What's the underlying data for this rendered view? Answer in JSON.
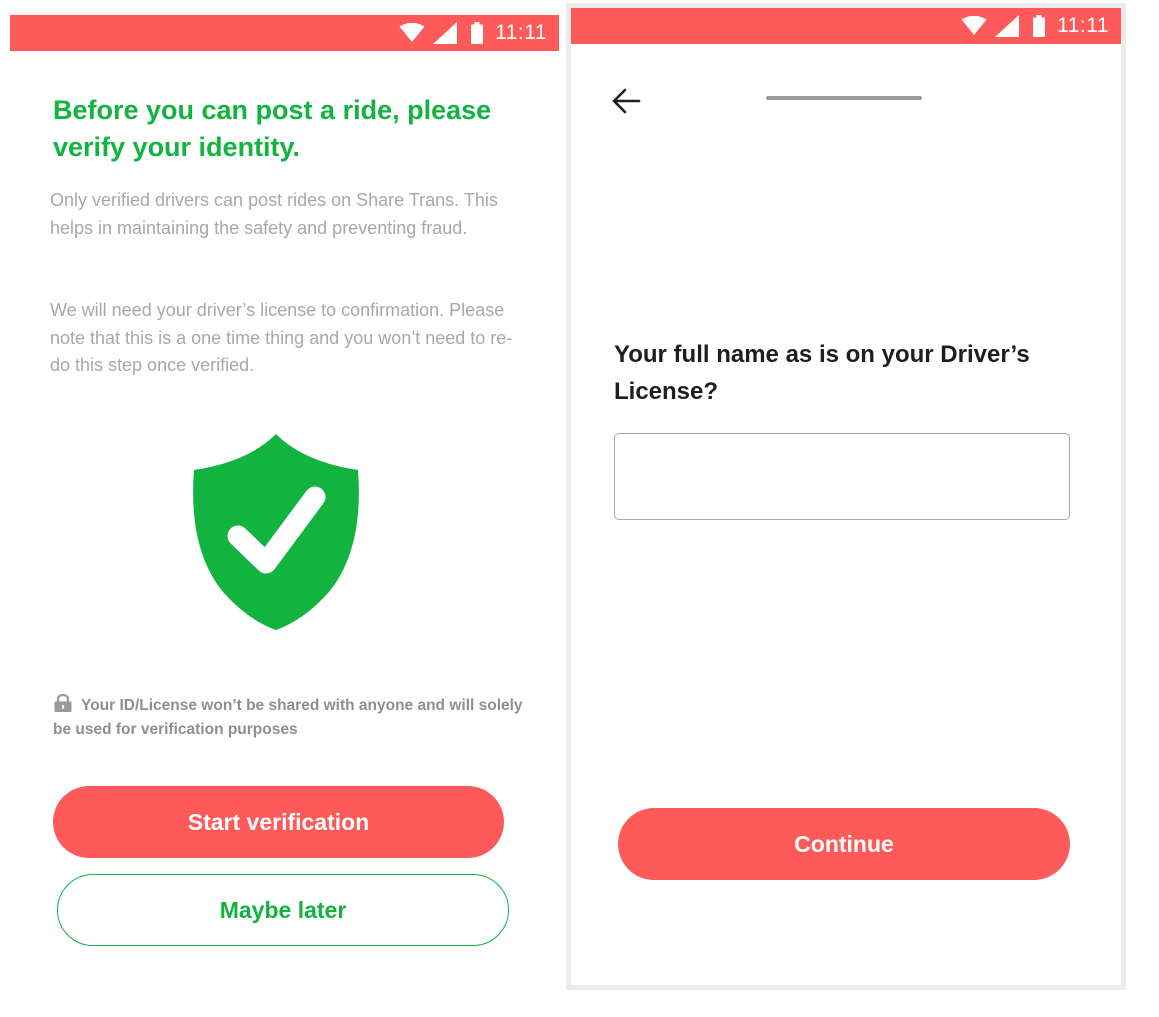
{
  "status_bar": {
    "time": "11:11",
    "icons": [
      "wifi-icon",
      "cellular-signal-icon",
      "battery-icon"
    ],
    "background_color": "#ff5a5a"
  },
  "colors": {
    "brand_green": "#12b43f",
    "accent_red": "#ff5a5a",
    "muted_text": "#a8a8a8"
  },
  "intro_screen": {
    "title": "Before you can post a ride, please verify your identity.",
    "paragraph_1": "Only verified drivers can post rides on Share Trans. This helps in maintaining the safety and preventing fraud.",
    "paragraph_2": "We will need your driver’s license to confirmation. Please note that this is a one time thing and you won’t need to re-do this step once verified.",
    "illustration": "shield-check-icon",
    "privacy_note": "Your ID/License won’t be shared with anyone and will solely be used for verification purposes",
    "privacy_icon": "lock-icon",
    "start_button_label": "Start verification",
    "later_button_label": "Maybe later"
  },
  "name_screen": {
    "back_icon": "arrow-left-icon",
    "progress_fraction": 1.0,
    "question": "Your full name as is on your Driver’s License?",
    "name_input": {
      "value": "",
      "placeholder": ""
    },
    "continue_button_label": "Continue"
  }
}
